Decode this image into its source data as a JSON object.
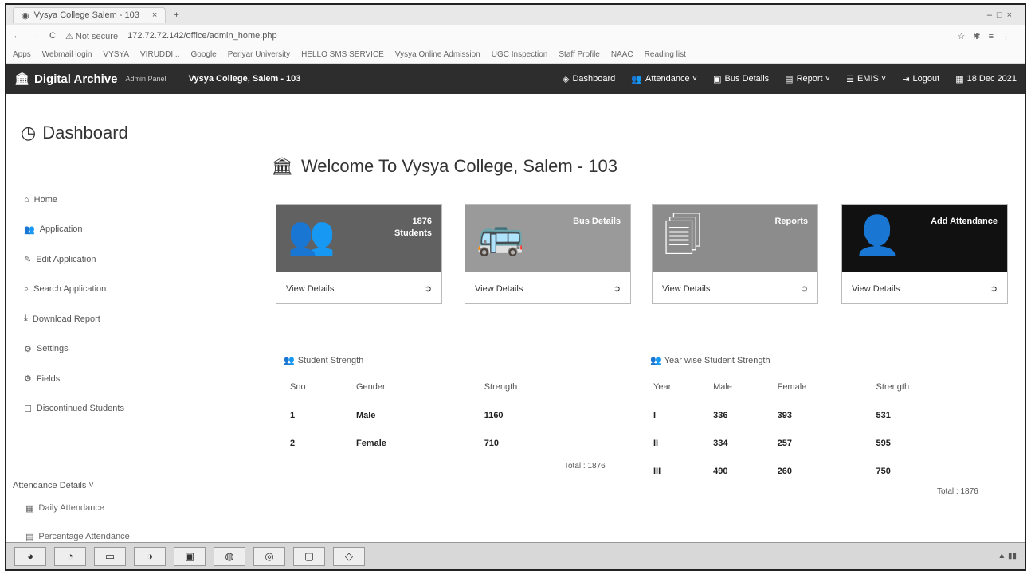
{
  "browser": {
    "tab_title": "Vysya College Salem - 103",
    "url_security": "Not secure",
    "url": "172.72.72.142/office/admin_home.php",
    "bookmarks": [
      "Apps",
      "Webmail login",
      "VYSYA",
      "VIRUDDI...",
      "Google",
      "Periyar University",
      "HELLO SMS SERVICE",
      "Vysya Online Admission",
      "UGC Inspection",
      "Staff Profile",
      "NAAC",
      "Reading list"
    ]
  },
  "navbar": {
    "brand": "Digital Archive",
    "brand_sub": "Admin Panel",
    "college": "Vysya College, Salem - 103",
    "items": [
      {
        "label": "Dashboard",
        "icon": "dashboard-icon"
      },
      {
        "label": "Attendance ˅",
        "icon": "users-icon"
      },
      {
        "label": "Bus Details",
        "icon": "bus-icon"
      },
      {
        "label": "Report ˅",
        "icon": "report-icon"
      },
      {
        "label": "EMIS ˅",
        "icon": "list-icon"
      },
      {
        "label": "Logout",
        "icon": "logout-icon"
      },
      {
        "label": "18 Dec 2021",
        "icon": "calendar-icon"
      }
    ]
  },
  "sidebar": {
    "title": "Dashboard",
    "items": [
      {
        "label": "Home",
        "icon": "home-icon"
      },
      {
        "label": "Application",
        "icon": "users-icon"
      },
      {
        "label": "Edit Application",
        "icon": "edit-icon"
      },
      {
        "label": "Search Application",
        "icon": "search-icon"
      },
      {
        "label": "Download Report",
        "icon": "download-icon"
      },
      {
        "label": "Settings",
        "icon": "gear-icon"
      },
      {
        "label": "Fields",
        "icon": "gear-icon"
      },
      {
        "label": "Discontinued Students",
        "icon": "square-icon"
      }
    ],
    "attendance_header": "Attendance Details ˅",
    "attendance_items": [
      "Daily Attendance",
      "Percentage Attendance"
    ]
  },
  "welcome": "Welcome To Vysya College, Salem - 103",
  "cards": [
    {
      "top_text": "1876",
      "label": "Students",
      "footer": "View Details",
      "color": "#616161"
    },
    {
      "top_text": "",
      "label": "Bus Details",
      "footer": "View Details",
      "color": "#9a9a9a"
    },
    {
      "top_text": "",
      "label": "Reports",
      "footer": "View Details",
      "color": "#8c8c8c"
    },
    {
      "top_text": "",
      "label": "Add Attendance",
      "footer": "View Details",
      "color": "#111111"
    }
  ],
  "student_strength": {
    "title": "Student Strength",
    "headers": [
      "Sno",
      "Gender",
      "Strength"
    ],
    "rows": [
      [
        "1",
        "Male",
        "1160"
      ],
      [
        "2",
        "Female",
        "710"
      ]
    ],
    "total": "Total : 1876"
  },
  "year_strength": {
    "title": "Year wise Student Strength",
    "headers": [
      "Year",
      "Male",
      "Female",
      "Strength"
    ],
    "rows": [
      [
        "I",
        "336",
        "393",
        "531"
      ],
      [
        "II",
        "334",
        "257",
        "595"
      ],
      [
        "III",
        "490",
        "260",
        "750"
      ]
    ],
    "total": "Total : 1876"
  }
}
